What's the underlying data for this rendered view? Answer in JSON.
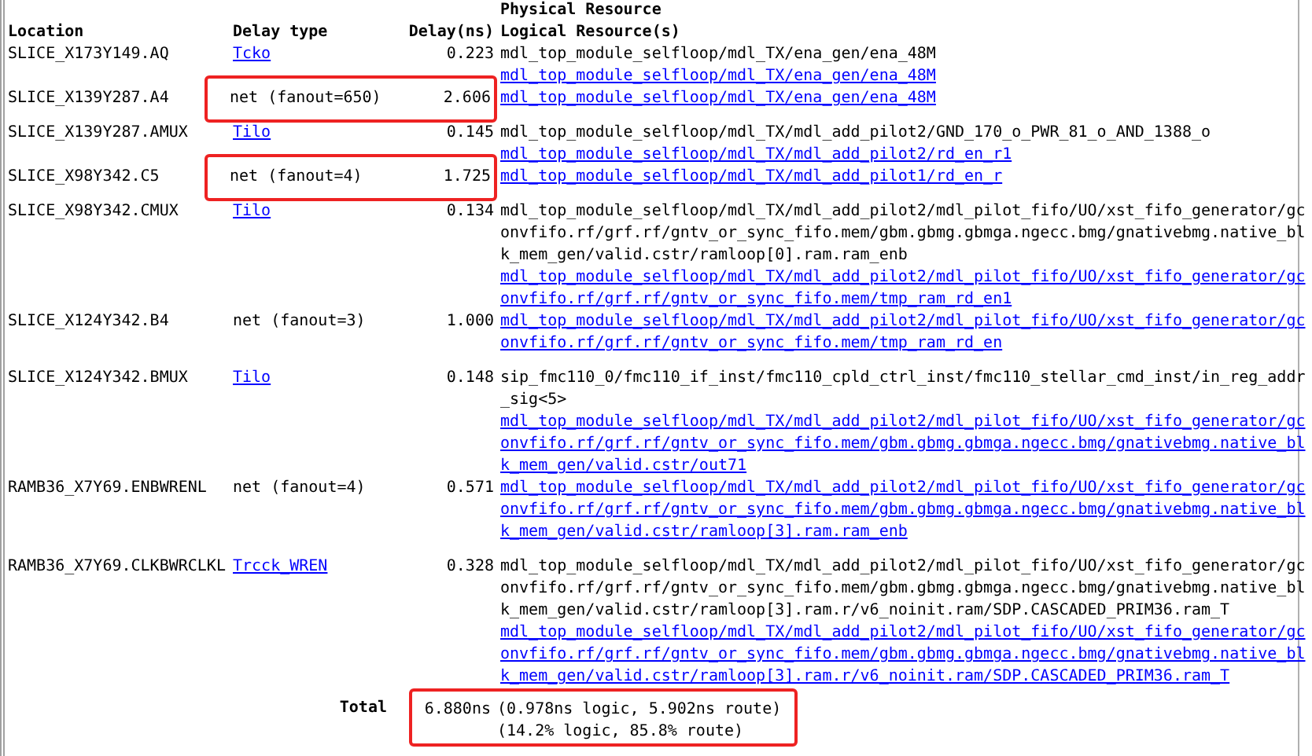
{
  "table": {
    "columns": [
      {
        "label": "Location"
      },
      {
        "label": "Delay type"
      },
      {
        "label": "Delay(ns)"
      },
      {
        "label_lines": [
          "Physical Resource",
          "Logical Resource(s)"
        ]
      }
    ],
    "rows": [
      {
        "kind": "logic",
        "location": "SLICE_X173Y149.AQ",
        "delay_type": "Tcko",
        "delay": "0.223",
        "highlighted": false,
        "resources": [
          {
            "text": "mdl_top_module_selfloop/mdl_TX/ena_gen/ena_48M",
            "link": false
          },
          {
            "text": "mdl_top_module_selfloop/mdl_TX/ena_gen/ena_48M",
            "link": true
          }
        ]
      },
      {
        "kind": "net",
        "location": "SLICE_X139Y287.A4",
        "delay_type": "net (fanout=650)",
        "delay": "2.606",
        "highlighted": true,
        "resources": [
          {
            "text": "mdl_top_module_selfloop/mdl_TX/ena_gen/ena_48M",
            "link": true
          }
        ]
      },
      {
        "kind": "logic",
        "location": "SLICE_X139Y287.AMUX",
        "delay_type": "Tilo",
        "delay": "0.145",
        "highlighted": false,
        "resources": [
          {
            "text": "mdl_top_module_selfloop/mdl_TX/mdl_add_pilot2/GND_170_o_PWR_81_o_AND_1388_o",
            "link": false
          },
          {
            "text": "mdl_top_module_selfloop/mdl_TX/mdl_add_pilot2/rd_en_r1",
            "link": true
          }
        ]
      },
      {
        "kind": "net",
        "location": "SLICE_X98Y342.C5",
        "delay_type": "net (fanout=4)",
        "delay": "1.725",
        "highlighted": true,
        "resources": [
          {
            "text": "mdl_top_module_selfloop/mdl_TX/mdl_add_pilot1/rd_en_r",
            "link": true
          }
        ]
      },
      {
        "kind": "logic",
        "location": "SLICE_X98Y342.CMUX",
        "delay_type": "Tilo",
        "delay": "0.134",
        "highlighted": false,
        "resources": [
          {
            "text": "mdl_top_module_selfloop/mdl_TX/mdl_add_pilot2/mdl_pilot_fifo/UO/xst_fifo_generator/gconvfifo.rf/grf.rf/gntv_or_sync_fifo.mem/gbm.gbmg.gbmga.ngecc.bmg/gnativebmg.native_blk_mem_gen/valid.cstr/ramloop[0].ram.ram_enb",
            "link": false
          },
          {
            "text": "mdl_top_module_selfloop/mdl_TX/mdl_add_pilot2/mdl_pilot_fifo/UO/xst_fifo_generator/gconvfifo.rf/grf.rf/gntv_or_sync_fifo.mem/tmp_ram_rd_en1",
            "link": true
          }
        ]
      },
      {
        "kind": "net",
        "location": "SLICE_X124Y342.B4",
        "delay_type": "net (fanout=3)",
        "delay": "1.000",
        "highlighted": false,
        "resources": [
          {
            "text": "mdl_top_module_selfloop/mdl_TX/mdl_add_pilot2/mdl_pilot_fifo/UO/xst_fifo_generator/gconvfifo.rf/grf.rf/gntv_or_sync_fifo.mem/tmp_ram_rd_en",
            "link": true
          }
        ]
      },
      {
        "kind": "logic",
        "location": "SLICE_X124Y342.BMUX",
        "delay_type": "Tilo",
        "delay": "0.148",
        "highlighted": false,
        "resources": [
          {
            "text": "sip_fmc110_0/fmc110_if_inst/fmc110_cpld_ctrl_inst/fmc110_stellar_cmd_inst/in_reg_addr_sig<5>",
            "link": false
          },
          {
            "text": "mdl_top_module_selfloop/mdl_TX/mdl_add_pilot2/mdl_pilot_fifo/UO/xst_fifo_generator/gconvfifo.rf/grf.rf/gntv_or_sync_fifo.mem/gbm.gbmg.gbmga.ngecc.bmg/gnativebmg.native_blk_mem_gen/valid.cstr/out71",
            "link": true
          }
        ]
      },
      {
        "kind": "net",
        "location": "RAMB36_X7Y69.ENBWRENL",
        "delay_type": "net (fanout=4)",
        "delay": "0.571",
        "highlighted": false,
        "resources": [
          {
            "text": "mdl_top_module_selfloop/mdl_TX/mdl_add_pilot2/mdl_pilot_fifo/UO/xst_fifo_generator/gconvfifo.rf/grf.rf/gntv_or_sync_fifo.mem/gbm.gbmg.gbmga.ngecc.bmg/gnativebmg.native_blk_mem_gen/valid.cstr/ramloop[3].ram.ram_enb",
            "link": true
          }
        ]
      },
      {
        "kind": "logic",
        "location": "RAMB36_X7Y69.CLKBWRCLKL",
        "delay_type": "Trcck_WREN",
        "delay": "0.328",
        "highlighted": false,
        "resources": [
          {
            "text": "mdl_top_module_selfloop/mdl_TX/mdl_add_pilot2/mdl_pilot_fifo/UO/xst_fifo_generator/gconvfifo.rf/grf.rf/gntv_or_sync_fifo.mem/gbm.gbmg.gbmga.ngecc.bmg/gnativebmg.native_blk_mem_gen/valid.cstr/ramloop[3].ram.r/v6_noinit.ram/SDP.CASCADED_PRIM36.ram_T",
            "link": false
          },
          {
            "text": "mdl_top_module_selfloop/mdl_TX/mdl_add_pilot2/mdl_pilot_fifo/UO/xst_fifo_generator/gconvfifo.rf/grf.rf/gntv_or_sync_fifo.mem/gbm.gbmg.gbmga.ngecc.bmg/gnativebmg.native_blk_mem_gen/valid.cstr/ramloop[3].ram.r/v6_noinit.ram/SDP.CASCADED_PRIM36.ram_T",
            "link": true
          }
        ]
      }
    ],
    "total": {
      "label": "Total",
      "value": "6.880ns",
      "highlighted": true,
      "details": [
        "(0.978ns logic, 5.902ns route)",
        "(14.2% logic, 85.8% route)"
      ]
    }
  }
}
